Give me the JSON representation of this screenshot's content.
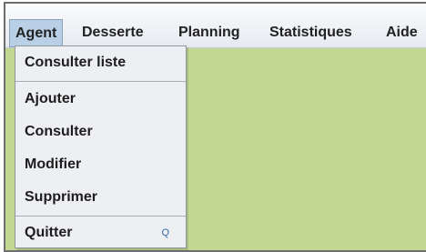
{
  "menubar": {
    "menus": [
      "Agent",
      "Desserte",
      "Planning",
      "Statistiques",
      "Aide"
    ]
  },
  "dropdown": {
    "items": [
      {
        "label": "Consulter liste"
      },
      {
        "label": "Ajouter"
      },
      {
        "label": "Consulter"
      },
      {
        "label": "Modifier"
      },
      {
        "label": "Supprimer"
      },
      {
        "label": "Quitter",
        "shortcut": "Q"
      }
    ]
  },
  "colors": {
    "workspace": "#c0d890",
    "menu_highlight": "#b9cfe6",
    "menu_background": "#edeff3"
  }
}
